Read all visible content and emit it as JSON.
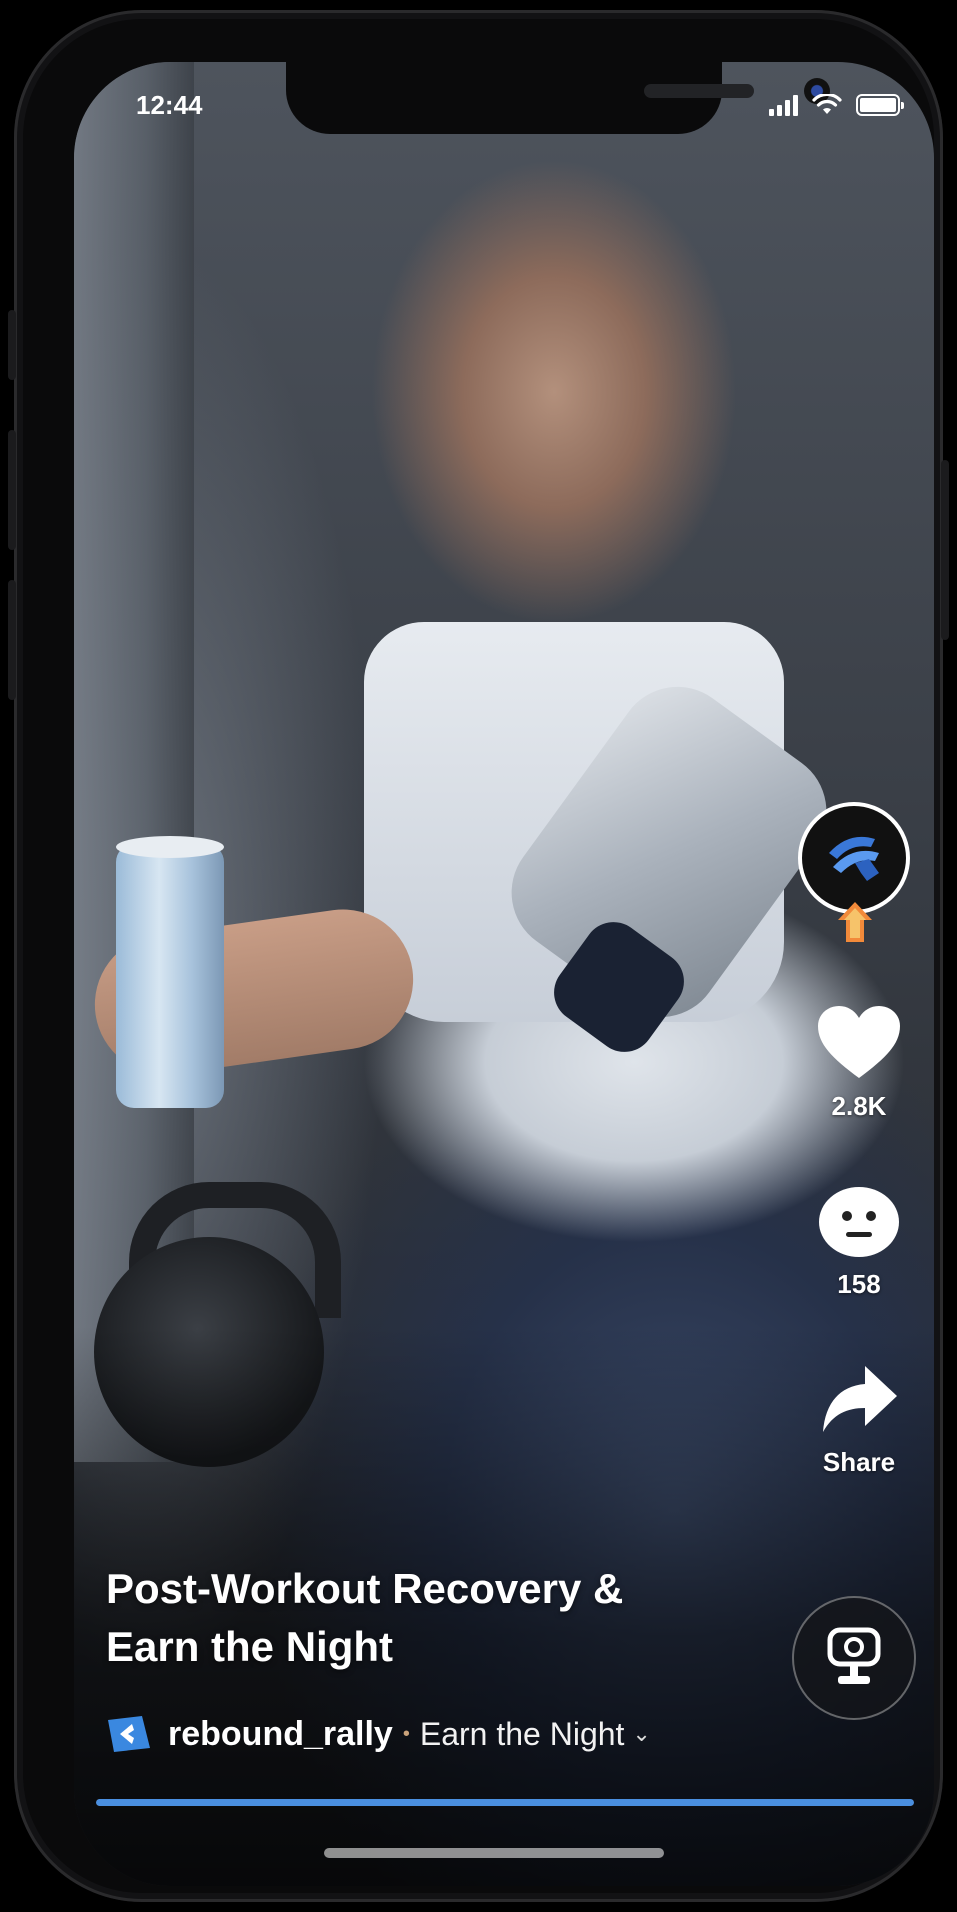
{
  "status_bar": {
    "time": "12:44"
  },
  "video": {
    "title_line1": "Post-Workout Recovery &",
    "title_line2": "Earn the Night",
    "username": "rebound_rally",
    "separator": "•",
    "sound": "Earn the Night",
    "progress_fraction": 1.0
  },
  "actions": {
    "likes": "2.8K",
    "comments": "158",
    "share": "Share"
  },
  "icons": {
    "like": "heart-icon",
    "comment": "face-icon",
    "share": "share-arrow-icon",
    "lens": "lens-camera-icon",
    "account": "brand-logo-icon",
    "sound_chevron": "chevron-down-icon"
  },
  "colors": {
    "progress": "#4a8fe0",
    "text": "#ffffff"
  }
}
